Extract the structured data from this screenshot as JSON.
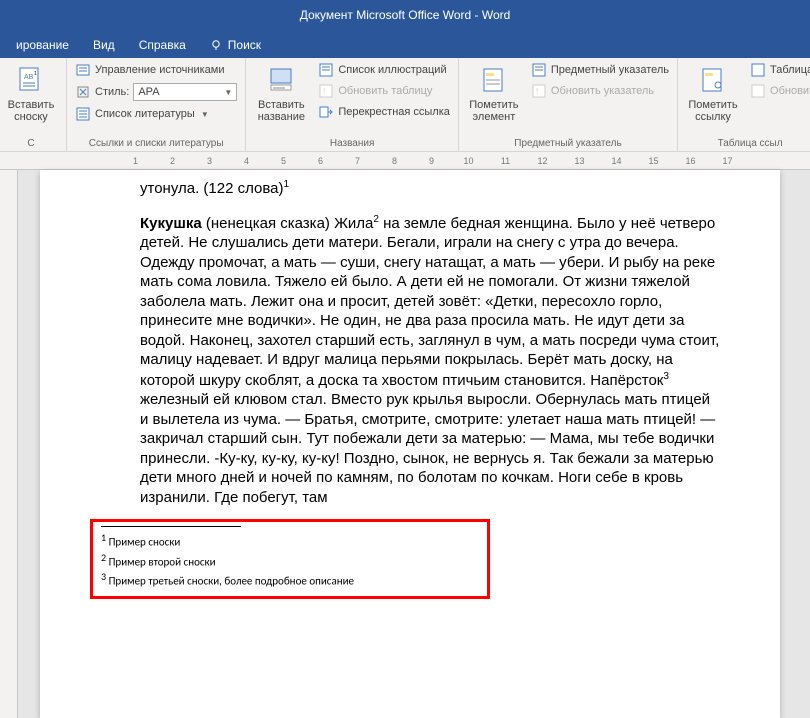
{
  "titlebar": {
    "text": "Документ Microsoft Office Word  -  Word"
  },
  "tabs": {
    "partial": "ирование",
    "view": "Вид",
    "help": "Справка",
    "tellme": "Поиск"
  },
  "ribbon": {
    "group_footnote": {
      "big": "Вставить сноску",
      "label": "С"
    },
    "group_citations": {
      "manage_sources": "Управление источниками",
      "style_label": "Стиль:",
      "style_value": "APA",
      "bibliography": "Список литературы",
      "label": "Ссылки и списки литературы"
    },
    "group_captions": {
      "big": "Вставить название",
      "list_figures": "Список иллюстраций",
      "update_table": "Обновить таблицу",
      "crossref": "Перекрестная ссылка",
      "label": "Названия"
    },
    "group_index": {
      "big": "Пометить элемент",
      "insert_index": "Предметный указатель",
      "update_index": "Обновить указатель",
      "label": "Предметный указатель"
    },
    "group_toa": {
      "big": "Пометить ссылку",
      "table_auth": "Таблица",
      "update_auth": "Обновит",
      "label": "Таблица ссыл"
    }
  },
  "ruler": [
    "",
    "1",
    "2",
    "3",
    "4",
    "5",
    "6",
    "7",
    "8",
    "9",
    "10",
    "11",
    "12",
    "13",
    "14",
    "15",
    "16",
    "17"
  ],
  "document": {
    "para1_text": "утонула. (122 слова)",
    "para2_bold": "Кукушка",
    "para2_part1": " (ненецкая сказка) Жила",
    "para2_part2": " на земле бедная женщина. Было у неё четверо детей. Не слушались дети матери. Бегали, играли на снегу с утра до вечера. Одежду промочат, а мать — суши, снегу натащат, а мать — убери. И рыбу на реке мать сома ловила. Тяжело ей было. А дети ей не помогали. От жизни тяжелой заболела мать. Лежит она и просит, детей зовёт: «Детки, пересохло горло, принесите мне водички». Не один, не два раза просила мать. Не идут дети за водой. Наконец, захотел старший есть, заглянул в чум, а мать посреди чума стоит, малицу надевает. И вдруг малица перьями покрылась. Берёт мать доску, на которой шкуру скоблят, а доска та хвостом птичьим становится. Напёрсток",
    "para2_part3": " железный ей клювом стал. Вместо рук крылья выросли. Обернулась мать птицей и вылетела из чума. — Братья, смотрите, смотрите: улетает наша мать птицей! — закричал старший сын. Тут побежали дети за матерью: — Мама, мы тебе водички принесли. -Ку-ку, ку-ку, ку-ку! Поздно, сынок, не вернусь я. Так бежали за матерью дети много дней и ночей по камням, по болотам по кочкам. Ноги себе в кровь изранили. Где побегут, там",
    "footnotes": {
      "f1": "Пример сноски",
      "f2": "Пример второй сноски",
      "f3": "Пример третьей сноски, более подробное описание"
    }
  }
}
